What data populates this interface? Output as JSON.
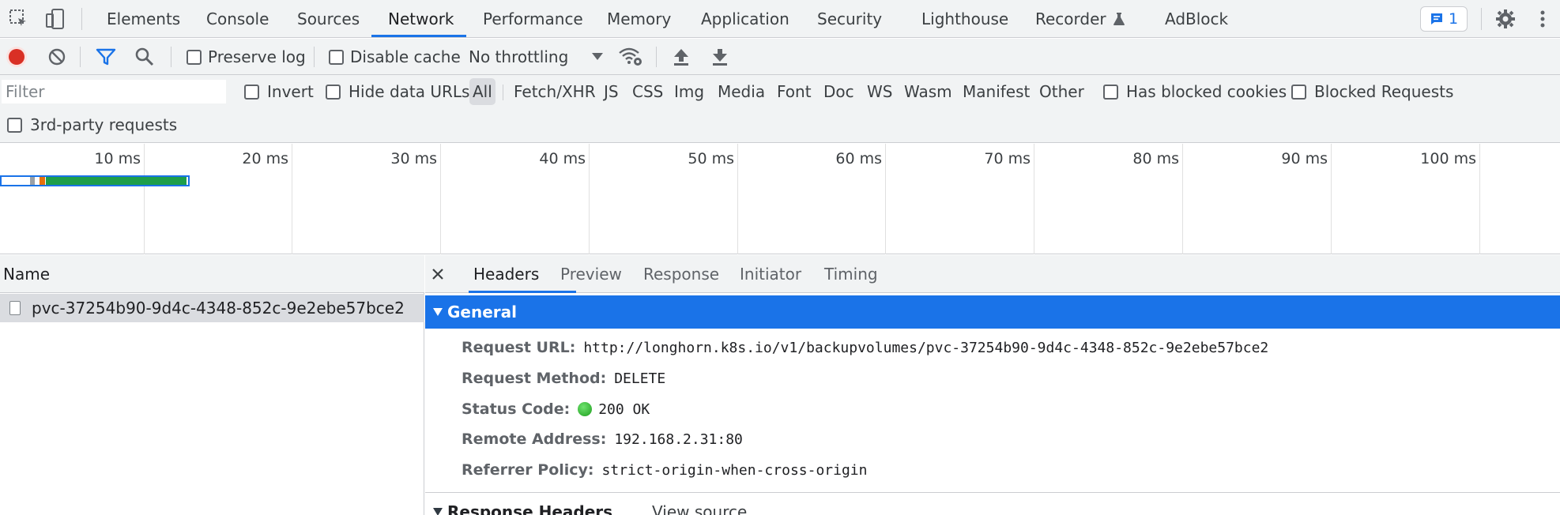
{
  "top_tabs": [
    {
      "label": "Elements"
    },
    {
      "label": "Console"
    },
    {
      "label": "Sources"
    },
    {
      "label": "Network",
      "active": true
    },
    {
      "label": "Performance"
    },
    {
      "label": "Memory"
    },
    {
      "label": "Application"
    },
    {
      "label": "Security"
    },
    {
      "label": "Lighthouse"
    },
    {
      "label": "Recorder"
    },
    {
      "label": "AdBlock"
    }
  ],
  "issues_badge": {
    "count": "1"
  },
  "toolbar": {
    "preserve_log": "Preserve log",
    "disable_cache": "Disable cache",
    "throttling": "No throttling"
  },
  "filter": {
    "placeholder": "Filter",
    "invert": "Invert",
    "hide_data_urls": "Hide data URLs",
    "types": [
      "All",
      "Fetch/XHR",
      "JS",
      "CSS",
      "Img",
      "Media",
      "Font",
      "Doc",
      "WS",
      "Wasm",
      "Manifest",
      "Other"
    ],
    "has_blocked_cookies": "Has blocked cookies",
    "blocked_requests": "Blocked Requests",
    "third_party": "3rd-party requests"
  },
  "timeline": {
    "ticks": [
      "10 ms",
      "20 ms",
      "30 ms",
      "40 ms",
      "50 ms",
      "60 ms",
      "70 ms",
      "80 ms",
      "90 ms",
      "100 ms"
    ]
  },
  "requests": {
    "column_name": "Name",
    "rows": [
      {
        "name": "pvc-37254b90-9d4c-4348-852c-9e2ebe57bce2",
        "selected": true
      }
    ]
  },
  "details": {
    "tabs": [
      "Headers",
      "Preview",
      "Response",
      "Initiator",
      "Timing"
    ],
    "active_tab": "Headers",
    "general_title": "General",
    "general": {
      "request_url_label": "Request URL:",
      "request_url": "http://longhorn.k8s.io/v1/backupvolumes/pvc-37254b90-9d4c-4348-852c-9e2ebe57bce2",
      "request_method_label": "Request Method:",
      "request_method": "DELETE",
      "status_code_label": "Status Code:",
      "status_code": "200 OK",
      "remote_address_label": "Remote Address:",
      "remote_address": "192.168.2.31:80",
      "referrer_policy_label": "Referrer Policy:",
      "referrer_policy": "strict-origin-when-cross-origin"
    },
    "response_headers_title": "Response Headers",
    "view_source": "View source"
  },
  "colors": {
    "accent": "#1a73e8",
    "record": "#d93025",
    "status_ok": "#1e9e1e"
  }
}
